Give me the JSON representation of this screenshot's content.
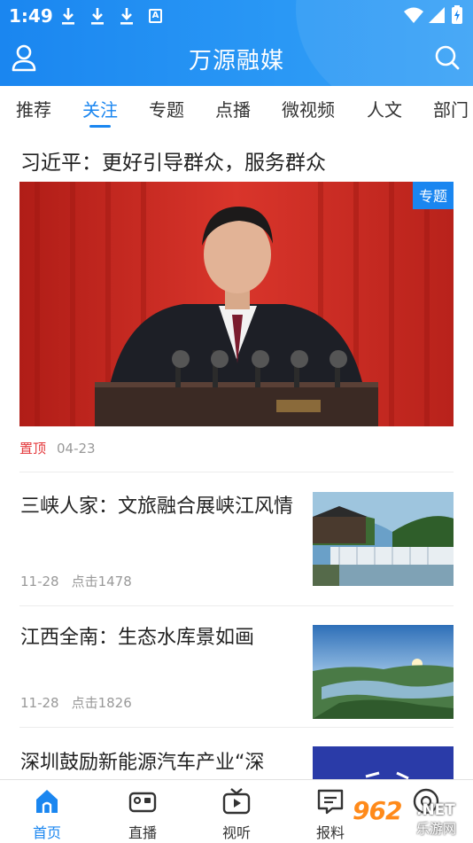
{
  "status_bar": {
    "time": "1:49",
    "notification_icons": [
      "download-icon",
      "download-icon",
      "download-icon",
      "a-badge-icon"
    ],
    "badge_letter": "A",
    "system_icons": [
      "wifi-icon",
      "signal-icon",
      "battery-charging-icon"
    ]
  },
  "header": {
    "title": "万源融媒",
    "left_icon": "user-icon",
    "right_icon": "search-icon"
  },
  "tabs": [
    "推荐",
    "关注",
    "专题",
    "点播",
    "微视频",
    "人文",
    "部门"
  ],
  "active_tab": "关注",
  "feed": {
    "featured": {
      "title": "习近平：更好引导群众，服务群众",
      "tag": "专题",
      "pin_label": "置顶",
      "date": "04-23"
    },
    "items": [
      {
        "title": "三峡人家：文旅融合展峡江风情",
        "date": "11-28",
        "clicks": "点击1478"
      },
      {
        "title": "江西全南：生态水库景如画",
        "date": "11-28",
        "clicks": "点击1826"
      },
      {
        "title": "深圳鼓励新能源汽车产业“深"
      }
    ]
  },
  "bottom_nav": [
    {
      "label": "首页",
      "icon": "home-icon",
      "active": true
    },
    {
      "label": "直播",
      "icon": "video-camera-icon",
      "active": false
    },
    {
      "label": "视听",
      "icon": "tv-icon",
      "active": false
    },
    {
      "label": "报料",
      "icon": "message-icon",
      "active": false
    },
    {
      "label": "",
      "icon": "profile-circle-icon",
      "active": false
    }
  ],
  "watermark": {
    "number": "962",
    "suffix": ".NET",
    "name": "乐游网"
  },
  "colors": {
    "accent": "#1a86f0",
    "pin": "#e4393c",
    "watermark": "#ff8a1a"
  }
}
